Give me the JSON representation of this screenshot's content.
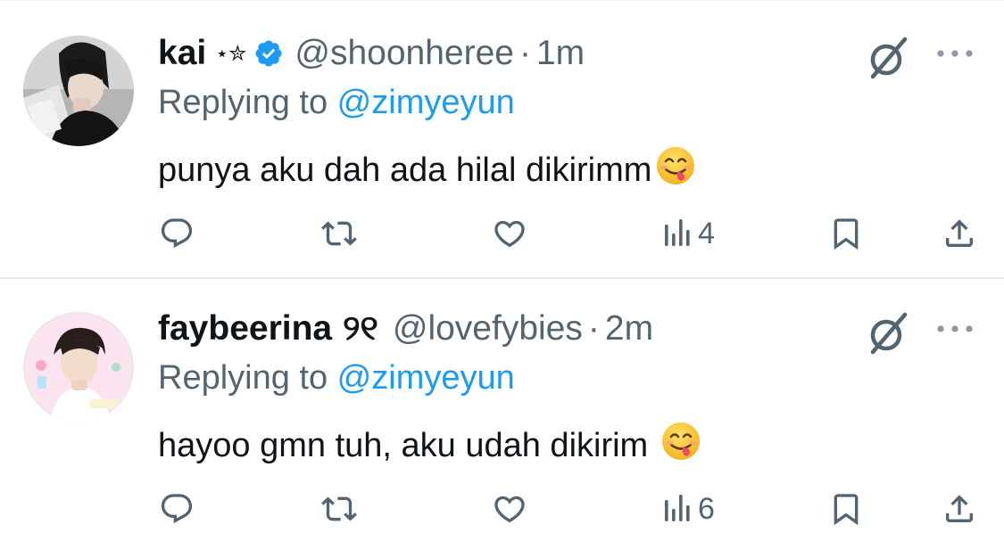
{
  "tweets": [
    {
      "name": "kai",
      "name_decoration": "⋆✮",
      "verified": true,
      "handle": "@shoonheree",
      "separator": "·",
      "time": "1m",
      "replying_to_prefix": "Replying to ",
      "replying_to_handle": "@zimyeyun",
      "text": "punya aku dah ada hilal dikirimm",
      "emoji": "savoring-food-face",
      "views": "4",
      "icons": [
        "reply-icon",
        "retweet-icon",
        "like-icon",
        "views-icon",
        "bookmark-icon",
        "share-icon"
      ]
    },
    {
      "name": "faybeerina",
      "name_decoration": "୨୧",
      "verified": false,
      "handle": "@lovefybies",
      "separator": "·",
      "time": "2m",
      "replying_to_prefix": "Replying to ",
      "replying_to_handle": "@zimyeyun",
      "text": "hayoo gmn tuh, aku udah dikirim",
      "emoji": "savoring-food-face",
      "views": "6",
      "icons": [
        "reply-icon",
        "retweet-icon",
        "like-icon",
        "views-icon",
        "bookmark-icon",
        "share-icon"
      ]
    }
  ],
  "colors": {
    "text": "#0f1419",
    "secondary": "#536471",
    "link": "#1d9bf0",
    "divider": "#e7ecef"
  }
}
